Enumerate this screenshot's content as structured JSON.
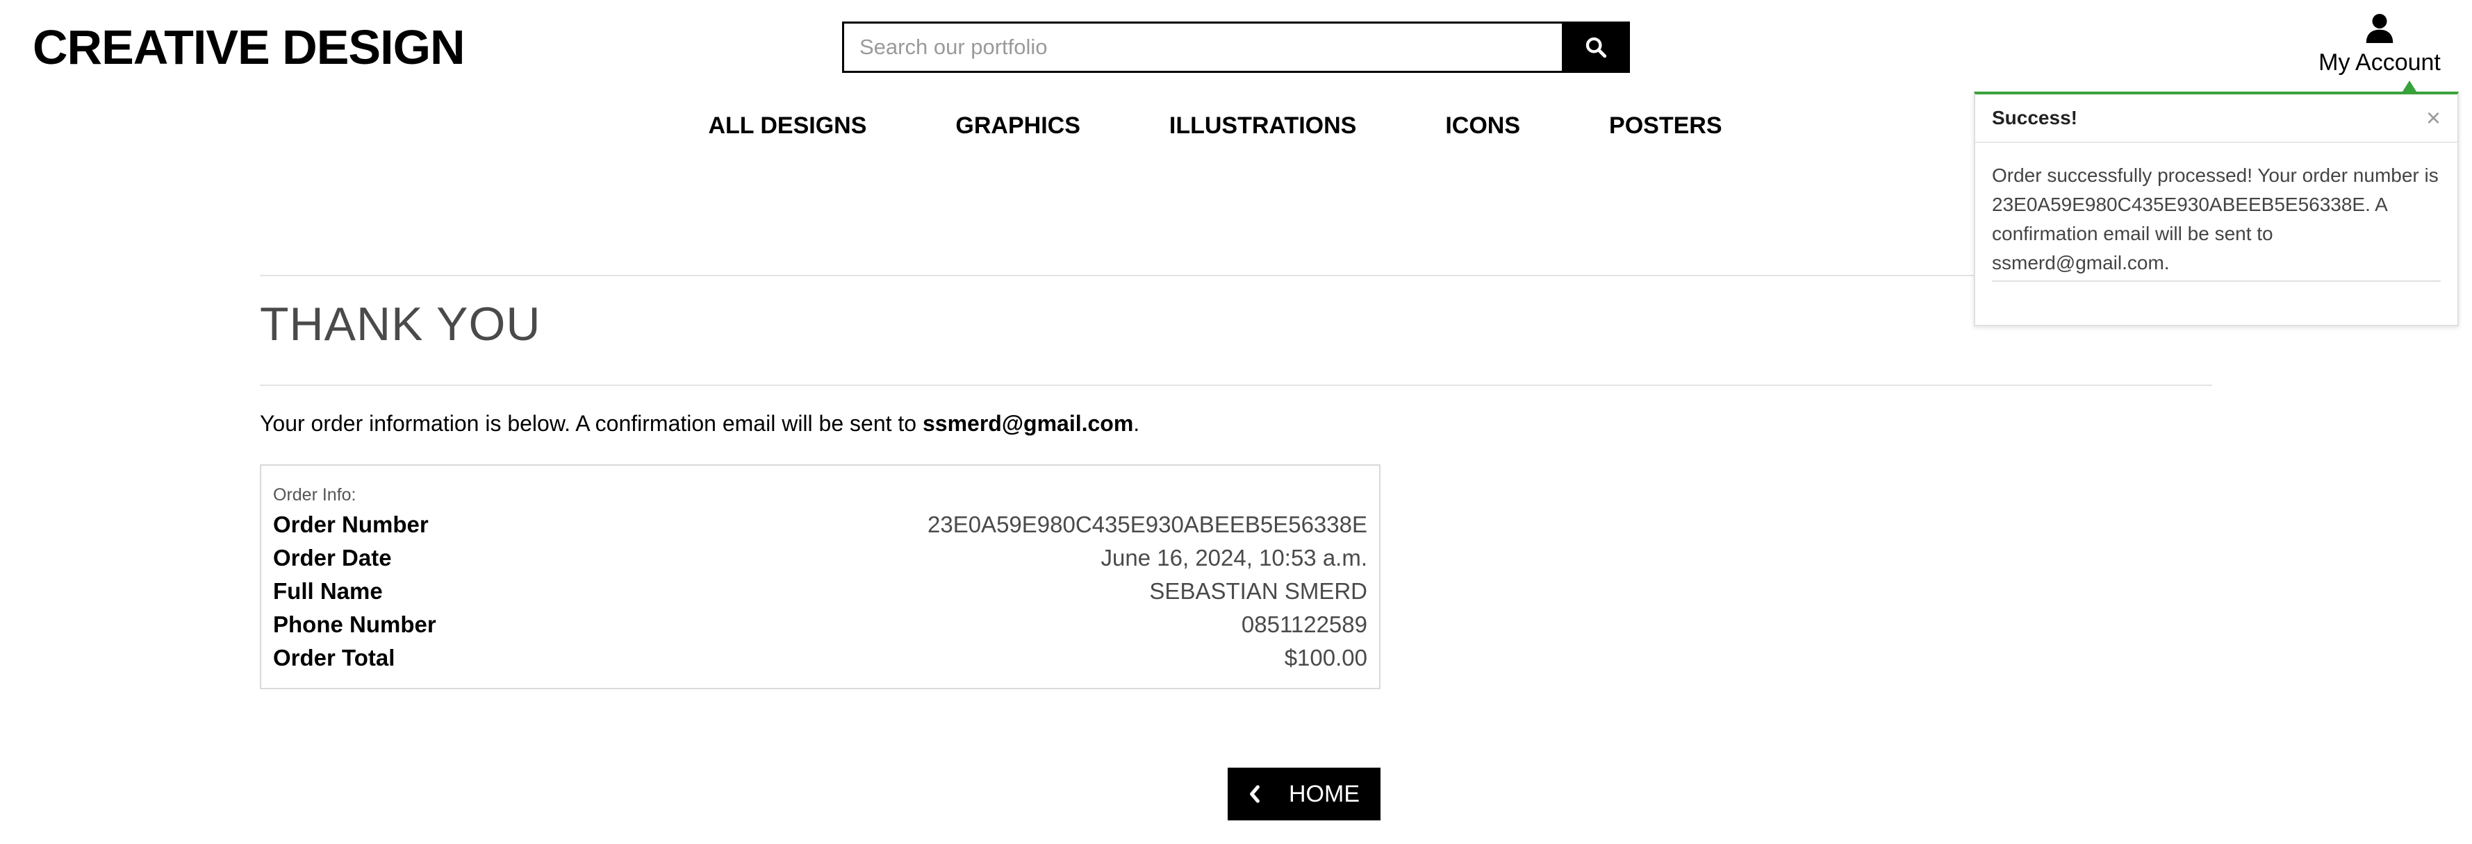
{
  "header": {
    "logo": "CREATIVE DESIGN",
    "search_placeholder": "Search our portfolio",
    "account_label": "My Account"
  },
  "nav": {
    "items": [
      "ALL DESIGNS",
      "GRAPHICS",
      "ILLUSTRATIONS",
      "ICONS",
      "POSTERS"
    ]
  },
  "main": {
    "title": "THANK YOU",
    "intro_prefix": "Your order information is below. A confirmation email will be sent to ",
    "intro_email": "ssmerd@gmail.com",
    "intro_suffix": ".",
    "order": {
      "caption": "Order Info:",
      "rows": [
        {
          "label": "Order Number",
          "value": "23E0A59E980C435E930ABEEB5E56338E"
        },
        {
          "label": "Order Date",
          "value": "June 16, 2024, 10:53 a.m."
        },
        {
          "label": "Full Name",
          "value": "SEBASTIAN SMERD"
        },
        {
          "label": "Phone Number",
          "value": "0851122589"
        },
        {
          "label": "Order Total",
          "value": "$100.00"
        }
      ]
    },
    "home_label": "HOME"
  },
  "toast": {
    "title": "Success!",
    "close": "×",
    "message": "Order successfully processed! Your order number is 23E0A59E980C435E930ABEEB5E56338E. A confirmation email will be sent to ssmerd@gmail.com.",
    "accent_color": "#3aa23a"
  }
}
